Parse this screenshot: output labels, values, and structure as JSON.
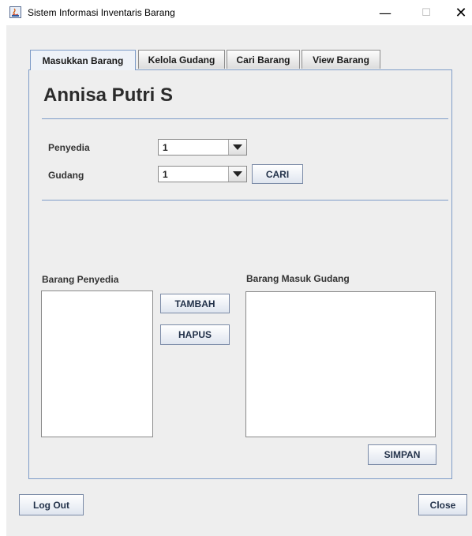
{
  "window": {
    "title": "Sistem Informasi Inventaris Barang",
    "controls": {
      "minimize": "—",
      "maximize": "☐",
      "close": "✕"
    }
  },
  "tabs": [
    {
      "label": "Masukkan Barang",
      "active": true
    },
    {
      "label": "Kelola Gudang",
      "active": false
    },
    {
      "label": "Cari Barang",
      "active": false
    },
    {
      "label": "View Barang",
      "active": false
    }
  ],
  "form": {
    "heading": "Annisa Putri S",
    "penyedia_label": "Penyedia",
    "penyedia_value": "1",
    "gudang_label": "Gudang",
    "gudang_value": "1",
    "cari_button": "CARI"
  },
  "lists": {
    "left_label": "Barang Penyedia",
    "right_label": "Barang Masuk Gudang"
  },
  "actions": {
    "tambah": "TAMBAH",
    "hapus": "HAPUS",
    "simpan": "SIMPAN"
  },
  "footer": {
    "logout": "Log Out",
    "close": "Close"
  },
  "colors": {
    "accent_border": "#7e9cc8",
    "panel_bg": "#eeeeee",
    "button_text": "#23324a"
  }
}
